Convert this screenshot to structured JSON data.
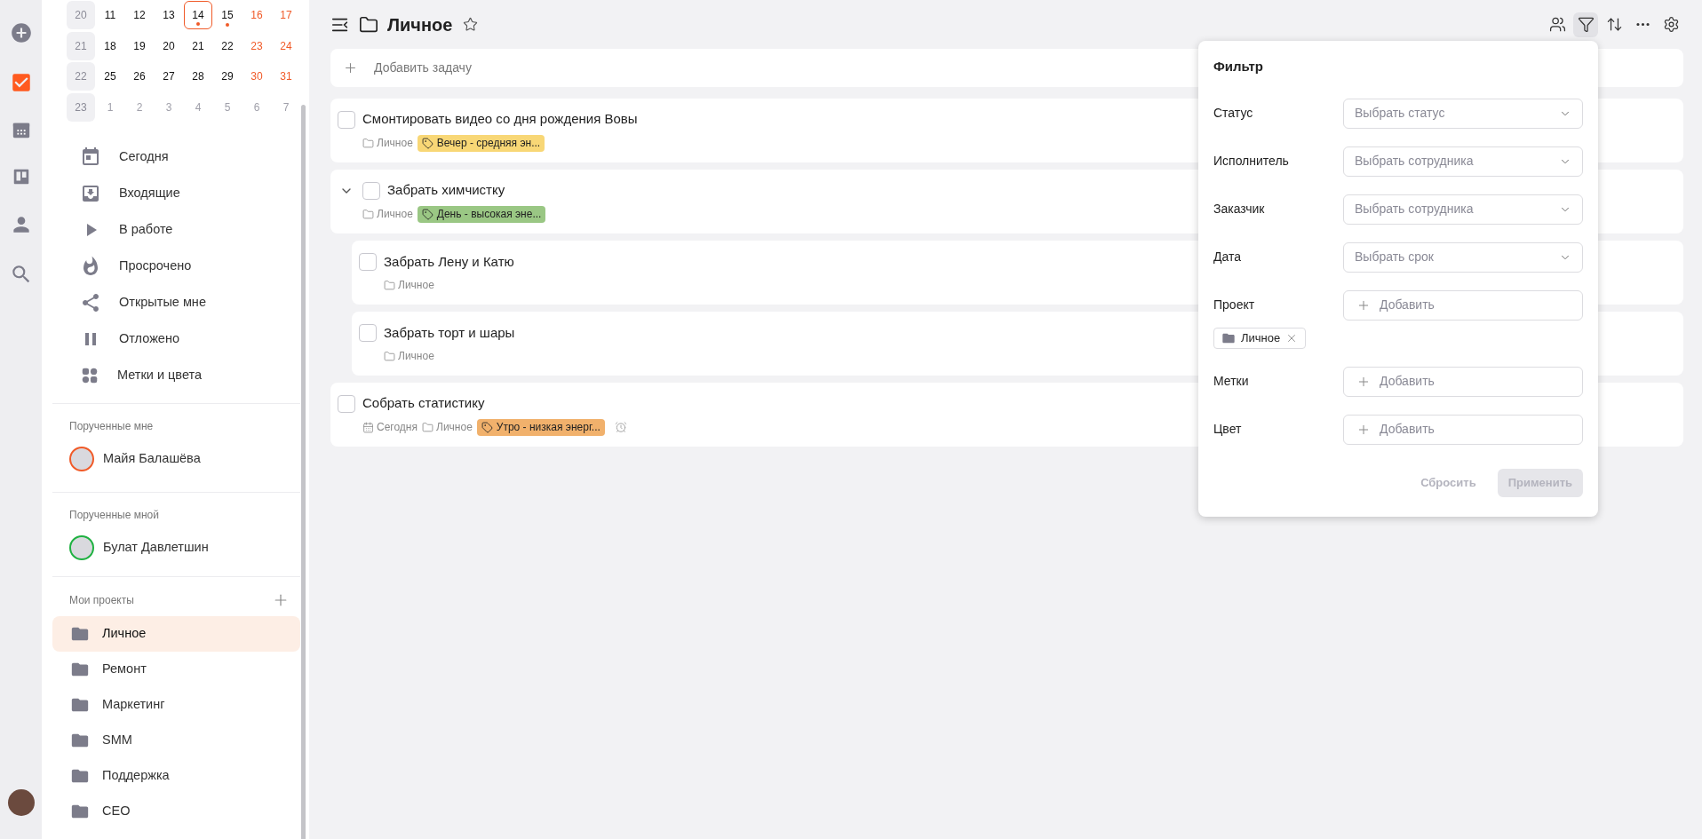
{
  "rail": {
    "items": [
      {
        "kind": "add",
        "selected": false
      },
      {
        "kind": "tasks",
        "selected": true
      },
      {
        "kind": "calendar",
        "selected": false
      },
      {
        "kind": "board",
        "selected": false
      },
      {
        "kind": "person",
        "selected": false
      },
      {
        "kind": "search",
        "selected": false
      }
    ]
  },
  "calendar": {
    "weeks": [
      {
        "week": "20",
        "days": [
          {
            "label": "11",
            "kind": "weekday",
            "today": false,
            "dot": false
          },
          {
            "label": "12",
            "kind": "weekday",
            "today": false,
            "dot": false
          },
          {
            "label": "13",
            "kind": "weekday",
            "today": false,
            "dot": false
          },
          {
            "label": "14",
            "kind": "weekday",
            "today": true,
            "dot": true
          },
          {
            "label": "15",
            "kind": "weekday",
            "today": false,
            "dot": true
          },
          {
            "label": "16",
            "kind": "weekend",
            "today": false,
            "dot": false
          },
          {
            "label": "17",
            "kind": "weekend",
            "today": false,
            "dot": false
          }
        ]
      },
      {
        "week": "21",
        "days": [
          {
            "label": "18",
            "kind": "weekday",
            "today": false,
            "dot": false
          },
          {
            "label": "19",
            "kind": "weekday",
            "today": false,
            "dot": false
          },
          {
            "label": "20",
            "kind": "weekday",
            "today": false,
            "dot": false
          },
          {
            "label": "21",
            "kind": "weekday",
            "today": false,
            "dot": false
          },
          {
            "label": "22",
            "kind": "weekday",
            "today": false,
            "dot": false
          },
          {
            "label": "23",
            "kind": "weekend",
            "today": false,
            "dot": false
          },
          {
            "label": "24",
            "kind": "weekend",
            "today": false,
            "dot": false
          }
        ]
      },
      {
        "week": "22",
        "days": [
          {
            "label": "25",
            "kind": "weekday",
            "today": false,
            "dot": false
          },
          {
            "label": "26",
            "kind": "weekday",
            "today": false,
            "dot": false
          },
          {
            "label": "27",
            "kind": "weekday",
            "today": false,
            "dot": false
          },
          {
            "label": "28",
            "kind": "weekday",
            "today": false,
            "dot": false
          },
          {
            "label": "29",
            "kind": "weekday",
            "today": false,
            "dot": false
          },
          {
            "label": "30",
            "kind": "weekend",
            "today": false,
            "dot": false
          },
          {
            "label": "31",
            "kind": "weekend",
            "today": false,
            "dot": false
          }
        ]
      },
      {
        "week": "23",
        "days": [
          {
            "label": "1",
            "kind": "other",
            "today": false,
            "dot": false
          },
          {
            "label": "2",
            "kind": "other",
            "today": false,
            "dot": false
          },
          {
            "label": "3",
            "kind": "other",
            "today": false,
            "dot": false
          },
          {
            "label": "4",
            "kind": "other",
            "today": false,
            "dot": false
          },
          {
            "label": "5",
            "kind": "other",
            "today": false,
            "dot": false
          },
          {
            "label": "6",
            "kind": "other",
            "today": false,
            "dot": false
          },
          {
            "label": "7",
            "kind": "other",
            "today": false,
            "dot": false
          }
        ]
      }
    ]
  },
  "nav": [
    {
      "kind": "today",
      "label": "Сегодня"
    },
    {
      "kind": "inbox",
      "label": "Входящие"
    },
    {
      "kind": "in_progress",
      "label": "В работе"
    },
    {
      "kind": "overdue",
      "label": "Просрочено"
    },
    {
      "kind": "shared",
      "label": "Открытые мне"
    },
    {
      "kind": "paused",
      "label": "Отложено"
    },
    {
      "kind": "tags",
      "label": "Метки и цвета"
    }
  ],
  "people_sections": [
    {
      "title": "Порученные мне",
      "people": [
        {
          "name": "Майя Балашёва",
          "color": "#f05a28"
        }
      ]
    },
    {
      "title": "Порученные мной",
      "people": [
        {
          "name": "Булат Давлетшин",
          "color": "#1fb141"
        }
      ]
    }
  ],
  "projects": {
    "title": "Мои проекты",
    "items": [
      {
        "label": "Личное",
        "selected": true
      },
      {
        "label": "Ремонт",
        "selected": false
      },
      {
        "label": "Маркетинг",
        "selected": false
      },
      {
        "label": "SMM",
        "selected": false
      },
      {
        "label": "Поддержка",
        "selected": false
      },
      {
        "label": "CEO",
        "selected": false
      }
    ]
  },
  "header": {
    "title": "Личное",
    "favorite": false,
    "toolbar": [
      {
        "kind": "people",
        "selected": false
      },
      {
        "kind": "filter",
        "selected": true
      },
      {
        "kind": "sort",
        "selected": false
      },
      {
        "kind": "more",
        "selected": false
      },
      {
        "kind": "settings",
        "selected": false
      }
    ]
  },
  "add_task": {
    "placeholder": "Добавить задачу"
  },
  "tasks": [
    {
      "title": "Смонтировать видео со дня рождения Вовы",
      "checked": false,
      "project": "Личное",
      "tag": {
        "label": "Вечер - средняя эн...",
        "color": "#f8d776"
      }
    },
    {
      "title": "Забрать химчистку",
      "checked": false,
      "expanded": true,
      "project": "Личное",
      "tag": {
        "label": "День - высокая эне...",
        "color": "#9ac784"
      },
      "children": [
        {
          "title": "Забрать Лену и Катю",
          "checked": false,
          "project": "Личное"
        },
        {
          "title": "Забрать торт и шары",
          "checked": false,
          "project": "Личное"
        }
      ]
    },
    {
      "title": "Собрать статистику",
      "checked": false,
      "date": "Сегодня",
      "project": "Личное",
      "tag": {
        "label": "Утро - низкая энерг...",
        "color": "#f1b16c"
      },
      "reminder": true
    }
  ],
  "filter": {
    "title": "Фильтр",
    "fields": [
      {
        "label": "Статус",
        "kind": "select",
        "placeholder": "Выбрать статус"
      },
      {
        "label": "Исполнитель",
        "kind": "select",
        "placeholder": "Выбрать сотрудника"
      },
      {
        "label": "Заказчик",
        "kind": "select",
        "placeholder": "Выбрать сотрудника"
      },
      {
        "label": "Дата",
        "kind": "select",
        "placeholder": "Выбрать срок"
      },
      {
        "label": "Проект",
        "kind": "add",
        "placeholder": "Добавить",
        "chips": [
          {
            "label": "Личное"
          }
        ]
      },
      {
        "label": "Метки",
        "kind": "add",
        "placeholder": "Добавить"
      },
      {
        "label": "Цвет",
        "kind": "add",
        "placeholder": "Добавить"
      }
    ],
    "reset": {
      "label": "Сбросить",
      "disabled": true
    },
    "apply": {
      "label": "Применить",
      "disabled": true
    }
  }
}
